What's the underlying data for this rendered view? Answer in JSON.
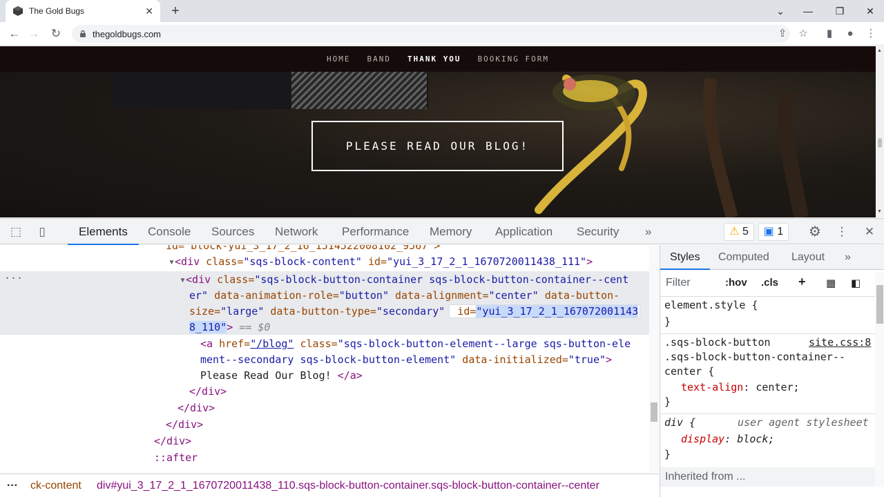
{
  "browser": {
    "tab_title": "The Gold Bugs",
    "url": "thegoldbugs.com",
    "new_tab_label": "+",
    "close_tab_label": "✕"
  },
  "site": {
    "nav": [
      "HOME",
      "BAND",
      "THANK YOU",
      "BOOKING FORM"
    ],
    "active_nav": "THANK YOU",
    "cta_button": "PLEASE READ OUR BLOG!"
  },
  "devtools": {
    "tabs": [
      "Elements",
      "Console",
      "Sources",
      "Network",
      "Performance",
      "Memory",
      "Application",
      "Security"
    ],
    "active_tab": "Elements",
    "more_tabs": "»",
    "warnings_count": "5",
    "messages_count": "1",
    "dom_lines": {
      "l0": "id=\"block-yui_3_17_2_16_1514522008102_9567\">",
      "l1_tag": "<div",
      "l1_attr": " class=",
      "l1_val": "\"sqs-block-content\"",
      "l1_attr2": " id=",
      "l1_val2": "\"yui_3_17_2_1_1670720011438_111\"",
      "l1_end": ">",
      "l2_tag": "<div",
      "l2_attr": " class=",
      "l2_val": "\"sqs-block-button-container sqs-block-button-container--cent",
      "l3_val": "er\"",
      "l3_attr": " data-animation-role=",
      "l3_val2": "\"button\"",
      "l3_attr2": " data-alignment=",
      "l3_val3": "\"center\"",
      "l3_attr3": " data-button-",
      "l4_attr": "size=",
      "l4_val": "\"large\"",
      "l4_attr2": " data-button-type=",
      "l4_val2": "\"secondary\"",
      "l4_attr3": " id=",
      "l4_val3": "\"yui_3_17_2_1_167072001143",
      "l5_val": "8_110\"",
      "l5_end": ">",
      "l5_eq": " == $0",
      "l6_tag": "<a",
      "l6_attr": " href=",
      "l6_val": "\"/blog\"",
      "l6_attr2": " class=",
      "l6_val2": "\"sqs-block-button-element--large sqs-button-ele",
      "l7_val": "ment--secondary sqs-block-button-element\"",
      "l7_attr": " data-initialized=",
      "l7_val2": "\"true\"",
      "l7_end": ">",
      "l8_text": "Please Read Our Blog! ",
      "l8_close": "</a>",
      "l9": "</div>",
      "l10": "</div>",
      "l11": "</div>",
      "l12": "</div>",
      "l13": "::after"
    },
    "breadcrumb": [
      "ck-content",
      "div#yui_3_17_2_1_1670720011438_110.sqs-block-button-container.sqs-block-button-container--center"
    ],
    "styles": {
      "tabs": [
        "Styles",
        "Computed",
        "Layout"
      ],
      "more_tabs": "»",
      "filter_placeholder": "Filter",
      "hov": ":hov",
      "cls": ".cls",
      "rule1_selector": "element.style {",
      "rule1_close": "}",
      "rule2_sel1": ".sqs-block-button",
      "rule2_source": "site.css:8",
      "rule2_sel2": ".sqs-block-button-container--",
      "rule2_sel3": "center {",
      "rule2_prop": "text-align",
      "rule2_val": "center;",
      "rule2_close": "}",
      "rule3_selector": "div {",
      "rule3_source": "user agent stylesheet",
      "rule3_prop": "display",
      "rule3_val": "block;",
      "rule3_close": "}",
      "inherited": "Inherited from ..."
    }
  },
  "icons": {
    "favicon": "cube-icon",
    "lock": "lock-icon",
    "inspect": "inspect-element-icon",
    "device": "device-toolbar-icon",
    "settings": "gear-icon",
    "kebab": "kebab-menu-icon",
    "close": "close-icon"
  },
  "colors": {
    "devtools_accent": "#1a73e8",
    "site_nav_bg": "#160b0b",
    "warning": "#f9ab00"
  }
}
